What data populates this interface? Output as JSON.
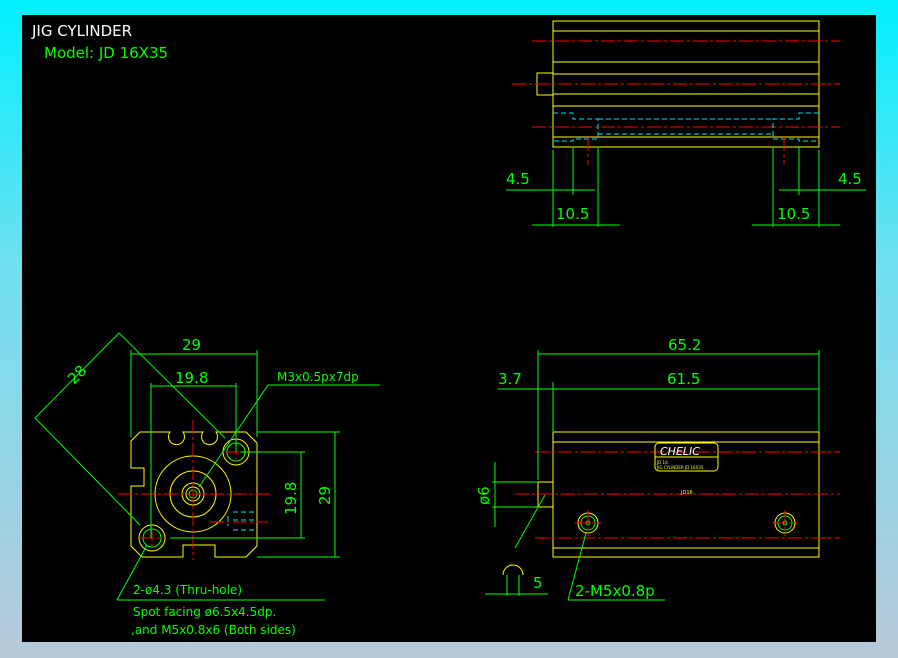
{
  "title": "JIG CYLINDER",
  "model": "Model:  JD 16X35",
  "colors": {
    "background": "#000000",
    "outline": "#ffff00",
    "dimension": "#00ff00",
    "centerline": "#ff0000",
    "hidden": "#00e5ff",
    "frame": "#00f0ff"
  },
  "top_view": {
    "dim_left_small": "4.5",
    "dim_left_large": "10.5",
    "dim_right_small": "4.5",
    "dim_right_large": "10.5"
  },
  "front_view": {
    "dim_width": "29",
    "dim_hole_spacing": "19.8",
    "dim_diagonal": "28",
    "dim_height": "29",
    "dim_hole_spacing_v": "19.8",
    "callout_thread": "M3x0.5px7dp",
    "callout_hole": "2-ø4.3 (Thru-hole)",
    "callout_spot1": "Spot facing ø6.5x4.5dp.",
    "callout_spot2": ",and M5x0.8x6 (Both sides)"
  },
  "side_view": {
    "dim_total": "65.2",
    "dim_body": "61.5",
    "dim_offset": "3.7",
    "dim_dia": "ø6",
    "dim_five": "5",
    "callout_ports": "2-M5x0.8p",
    "label_brand": "CHELIC",
    "label_line1": "JD 16",
    "label_line2": "JIG CYLINDER  JD 16X35",
    "part_mark": "JD16"
  }
}
